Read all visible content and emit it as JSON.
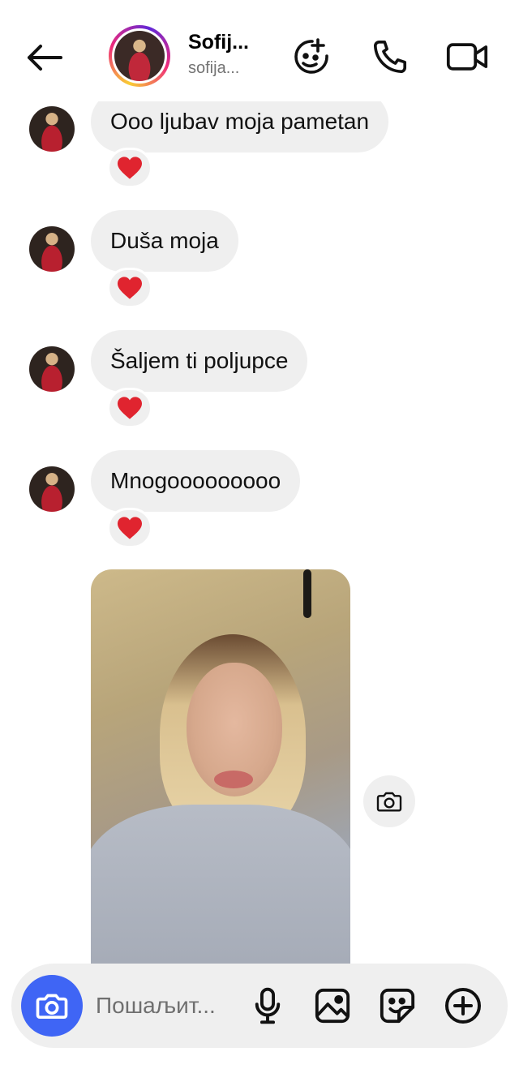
{
  "header": {
    "contact_name": "Sofij...",
    "contact_username": "sofija...",
    "icons": [
      "back-arrow-icon",
      "effects-icon",
      "phone-icon",
      "video-icon"
    ]
  },
  "messages": [
    {
      "text": "Ooo ljubav moja pametan",
      "reaction": "❤️"
    },
    {
      "text": "Duša moja",
      "reaction": "❤️"
    },
    {
      "text": "Šaljem ti poljupce",
      "reaction": "❤️"
    },
    {
      "text": "Mnogooooooooo",
      "reaction": "❤️"
    }
  ],
  "photo_message": {
    "icon": "camera-icon"
  },
  "composer": {
    "placeholder": "Пошаљит...",
    "icons": [
      "camera-icon",
      "microphone-icon",
      "gallery-icon",
      "sticker-icon",
      "plus-icon"
    ],
    "accent_color": "#3f65f5"
  }
}
